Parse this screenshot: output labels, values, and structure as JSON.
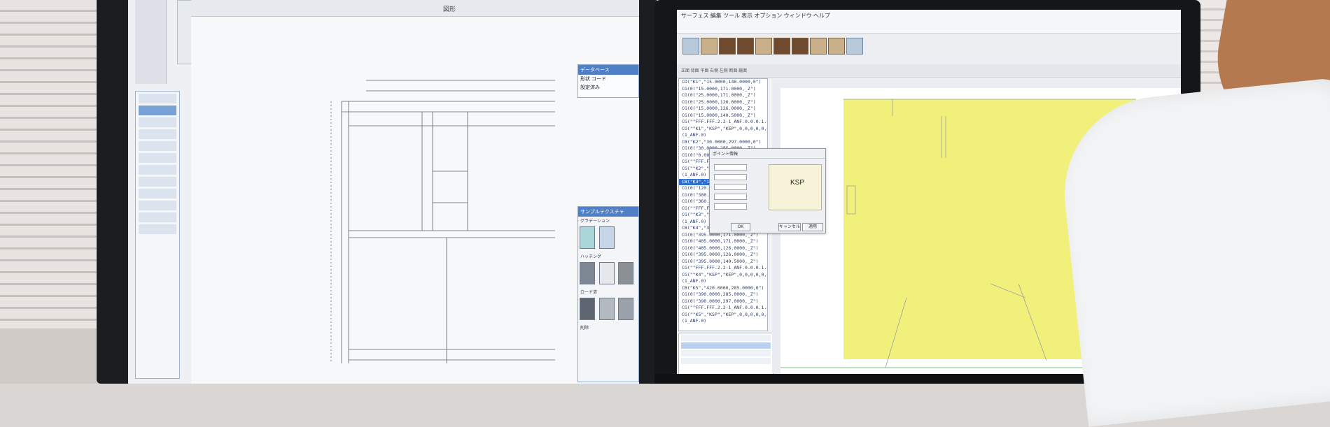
{
  "scene": {
    "description_tag": "office-cad-workstation"
  },
  "left_monitor": {
    "menubar_text": "図形",
    "attribute_panel": {
      "title": "データベース",
      "lines": [
        "形状 コード",
        "設定済み"
      ]
    },
    "sample_panel": {
      "title": "サンプルテクスチャ",
      "captions": [
        "グラデーション",
        "ハッチング",
        "ロード済",
        "削除"
      ]
    }
  },
  "right_monitor": {
    "title_bar": "サーフェス 編集 ツール 表示 オプション ウィンドウ ヘルプ",
    "tool_row": "正面 背面 平面 右側 左側 断面 鏡面",
    "code_lines": [
      "CD(\"K1\",\"15.0000,140.0000,0\")",
      "CG(0(\"15.0000,171.0000,_Z\")",
      "CG(0(\"25.0000,171.0000,_Z\")",
      "CG(0(\"25.0000,126.0000,_Z\")",
      "CG(0(\"15.0000,126.0000,_Z\")",
      "CG(0(\"15.0000,140.5000,_Z\")",
      "CG(\"\"FFF.FFF.2.2-1_ANF.0.0.0.1.0.4_AT\"",
      "CG(\"\"K1\",\"KSP\",\"KEP\",0,0,0,0,0,0\")",
      "(1_ANF.0)",
      "CB(\"K2\",\"30.0000,297.0000,0\")",
      "CG(0(\"30.0000,285.0000,_Z\")",
      "CG(0(\"0.0000,285.0000,_Z\")",
      "CG(\"\"FFF.FFF.2.2-1_ANF.0.0.0.1.0.4_AT\"",
      "CG(\"\"K2\",\"KSP\",\"KEP\",0,0,0,0,0,0\")",
      "(1_ANF.0)",
      "CB(\"K3\",\"100.0000,0.0000,0\")",
      "CG(0(\"120.0000,135.0000,_Z\")",
      "CG(0(\"300.0000,135.0000,_Z\")",
      "CG(0(\"360.0000,0.0000,_Z\")",
      "CG(\"\"FFF.FFF.2.2-1_ANF.0.0.0.1.0.4_AT\"",
      "CG(\"\"K3\",\"KSP\",\"KEP\",0,0,0,0,0,0\")",
      "(1_ANF.0)",
      "CB(\"K4\",\"395.0000,140.5000,0\")",
      "CG(0(\"395.0000,171.0000,_Z\")",
      "CG(0(\"405.0000,171.0000,_Z\")",
      "CG(0(\"405.0000,126.0000,_Z\")",
      "CG(0(\"395.0000,126.0000,_Z\")",
      "CG(0(\"395.0000,140.5000,_Z\")",
      "CG(\"\"FFF.FFF.2.2-1_ANF.0.0.0.1.0.4_AT\"",
      "CG(\"\"K4\",\"KSP\",\"KEP\",0,0,0,0,0,0\")",
      "(1_ANF.0)",
      "CB(\"K5\",\"420.0000,285.0000,0\")",
      "CG(0(\"390.0000,285.0000,_Z\")",
      "CG(0(\"390.0000,297.0000,_Z\")",
      "CG(\"\"FFF.FFF.2.2-1_ANF.0.0.0.1.0.4_AT\"",
      "CG(\"\"K5\",\"KSP\",\"KEP\",0,0,0,0,0,0\")",
      "(1_ANF.0)"
    ],
    "selected_line_index": 15,
    "canvas_label": "K3",
    "dialog": {
      "title": "ポイント情報",
      "preview_label": "KSP",
      "ok_label": "OK",
      "cancel_label": "キャンセル",
      "apply_label": "適用"
    }
  }
}
